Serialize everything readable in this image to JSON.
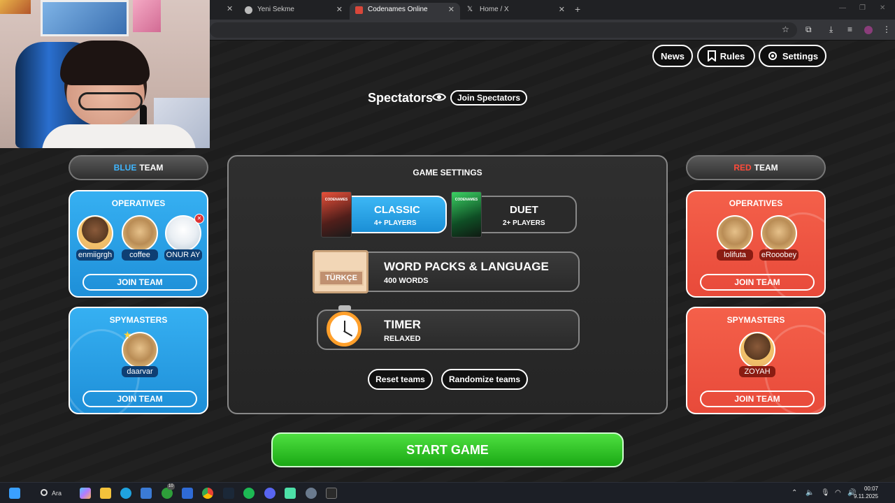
{
  "browser": {
    "tabs": [
      {
        "label": "Yeni Sekme"
      },
      {
        "label": "Codenames Online"
      },
      {
        "label": "Home / X"
      }
    ]
  },
  "header": {
    "news_label": "News",
    "rules_label": "Rules",
    "settings_label": "Settings"
  },
  "spectators": {
    "title": "Spectators",
    "join_label": "Join Spectators"
  },
  "blue_team": {
    "header_colored": "BLUE",
    "header_rest": "TEAM",
    "operatives_title": "OPERATIVES",
    "operatives": [
      "enmiigrgh",
      "coffee",
      "ONUR AY"
    ],
    "spymasters_title": "SPYMASTERS",
    "spymasters": [
      "daarvar"
    ],
    "join_label": "JOIN TEAM"
  },
  "red_team": {
    "header_colored": "RED",
    "header_rest": "TEAM",
    "operatives_title": "OPERATIVES",
    "operatives": [
      "lolifuta",
      "eRooobey"
    ],
    "spymasters_title": "SPYMASTERS",
    "spymasters": [
      "ZOYAH"
    ],
    "join_label": "JOIN TEAM"
  },
  "game_settings": {
    "title": "GAME SETTINGS",
    "classic": {
      "title": "CLASSIC",
      "subtitle": "4+ PLAYERS",
      "box_label": "CODENAMES"
    },
    "duet": {
      "title": "DUET",
      "subtitle": "2+ PLAYERS",
      "box_label": "CODENAMES"
    },
    "word_packs": {
      "title": "WORD PACKS & LANGUAGE",
      "subtitle": "400 WORDS",
      "language": "TÜRKÇE"
    },
    "timer": {
      "title": "TIMER",
      "subtitle": "RELAXED"
    },
    "reset_label": "Reset teams",
    "randomize_label": "Randomize teams"
  },
  "start_label": "START GAME",
  "taskbar": {
    "search_label": "Ara",
    "time": "00:07",
    "date": "9.11.2025",
    "badge": "10"
  },
  "colors": {
    "blue_accent": "#3fb6ff",
    "red_accent": "#ff4b3a",
    "start_green": "#2fc423"
  }
}
